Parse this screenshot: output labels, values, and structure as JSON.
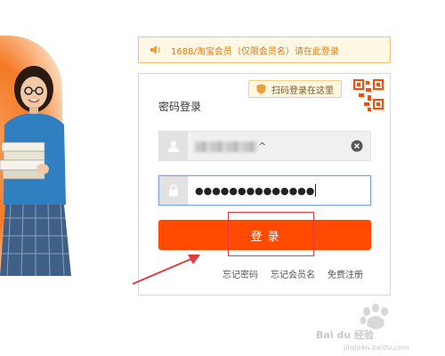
{
  "notice": {
    "text": "1688/淘宝会员（仅限会员名）请在此登录",
    "icon": "speaker-icon",
    "color": "#e07b14"
  },
  "login_card": {
    "qr_tip": "扫码登录在这里",
    "qr_tip_icon": "shield-icon",
    "qr_icon": "qr-code-icon",
    "title": "密码登录",
    "username": {
      "icon": "user-icon",
      "caret": "^",
      "clear_icon": "clear-icon"
    },
    "password": {
      "icon": "lock-icon",
      "masked_value": "●●●●●●●●●●●●●●"
    },
    "login_button": "登录",
    "links": [
      "忘记密码",
      "忘记会员名",
      "免费注册"
    ],
    "accent_color": "#ff4a00"
  },
  "annotations": {
    "highlight_color": "#e23b3b",
    "arrow_color": "#e23b3b"
  },
  "watermark": {
    "logo": "baidu-paw-logo",
    "text": "Bai du 经验",
    "subtext": "jingyan.baidu.com"
  }
}
